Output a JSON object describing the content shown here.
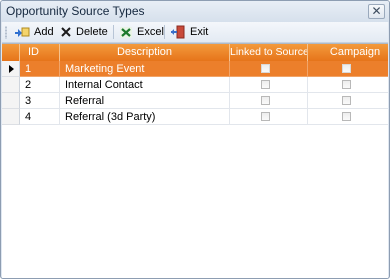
{
  "window": {
    "title": "Opportunity Source Types",
    "close_glyph": "✕"
  },
  "toolbar": {
    "add_label": "Add",
    "delete_label": "Delete",
    "excel_label": "Excel",
    "exit_label": "Exit"
  },
  "grid": {
    "columns": [
      "ID",
      "Description",
      "Linked to Source",
      "Campaign"
    ],
    "rows": [
      {
        "id": "1",
        "description": "Marketing Event",
        "linked_to_source": false,
        "campaign": false,
        "selected": true
      },
      {
        "id": "2",
        "description": "Internal Contact",
        "linked_to_source": false,
        "campaign": false,
        "selected": false
      },
      {
        "id": "3",
        "description": "Referral",
        "linked_to_source": false,
        "campaign": false,
        "selected": false
      },
      {
        "id": "4",
        "description": "Referral (3d Party)",
        "linked_to_source": false,
        "campaign": false,
        "selected": false
      }
    ]
  },
  "colors": {
    "header_orange": "#e6741a",
    "selected_row": "#ec7f2b"
  }
}
